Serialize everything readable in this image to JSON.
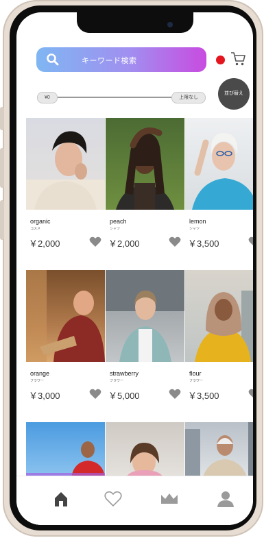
{
  "search": {
    "placeholder": "キーワード検索",
    "search_icon": "search-icon",
    "notification_icon": "red-dot-icon",
    "cart_icon": "cart-icon"
  },
  "price_filter": {
    "min_label": "¥0",
    "max_label": "上限なし",
    "sort_label": "並び替え"
  },
  "products": [
    {
      "name": "organic",
      "category": "コスメ",
      "price": "￥2,000"
    },
    {
      "name": "peach",
      "category": "シャツ",
      "price": "￥2,000"
    },
    {
      "name": "lemon",
      "category": "シャツ",
      "price": "￥3,500"
    },
    {
      "name": "orange",
      "category": "フラワー",
      "price": "￥3,000"
    },
    {
      "name": "strawberry",
      "category": "フラワー",
      "price": "￥5,000"
    },
    {
      "name": "flour",
      "category": "フラワー",
      "price": "￥3,500"
    }
  ],
  "tabbar": {
    "icons": [
      "home-icon",
      "heart-icon",
      "crown-icon",
      "profile-icon"
    ]
  },
  "colors": {
    "search_gradient_start": "#7fb6f2",
    "search_gradient_end": "#c84be0",
    "notification": "#e3161f",
    "icons": "#555555"
  }
}
